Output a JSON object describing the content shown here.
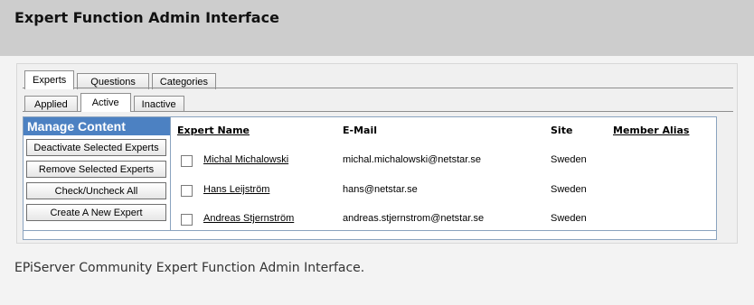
{
  "page": {
    "title": "Expert Function Admin Interface",
    "caption": "EPiServer Community Expert Function Admin Interface."
  },
  "tabs": {
    "top": [
      "Experts",
      "Questions",
      "Categories"
    ],
    "sub": [
      "Applied",
      "Active",
      "Inactive"
    ],
    "top_active": "Experts",
    "sub_active": "Active"
  },
  "manage": {
    "title": "Manage Content",
    "buttons": [
      "Deactivate Selected Experts",
      "Remove Selected Experts",
      "Check/Uncheck All",
      "Create A New Expert"
    ]
  },
  "table": {
    "headers": {
      "name": "Expert Name",
      "email": "E-Mail",
      "site": "Site",
      "alias": "Member Alias"
    },
    "rows": [
      {
        "name": "Michal Michalowski",
        "email": "michal.michalowski@netstar.se",
        "site": "Sweden",
        "alias": ""
      },
      {
        "name": "Hans Leijström",
        "email": "hans@netstar.se",
        "site": "Sweden",
        "alias": ""
      },
      {
        "name": "Andreas Stjernström",
        "email": "andreas.stjernstrom@netstar.se",
        "site": "Sweden",
        "alias": ""
      }
    ]
  },
  "colors": {
    "accent": "#4c81c2",
    "header_bg": "#cdcdcd"
  }
}
